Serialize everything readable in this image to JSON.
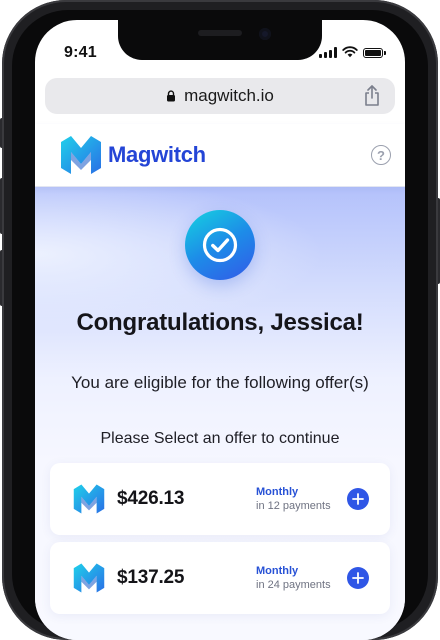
{
  "status_bar": {
    "time": "9:41"
  },
  "browser": {
    "url": "magwitch.io"
  },
  "app": {
    "brand_name": "Magwitch",
    "help_symbol": "?"
  },
  "main": {
    "headline": "Congratulations, Jessica!",
    "subheadline": "You are eligible for the following offer(s)",
    "prompt": "Please Select an offer to continue"
  },
  "offers": [
    {
      "amount": "$426.13",
      "frequency": "Monthly",
      "terms": "in 12 payments"
    },
    {
      "amount": "$137.25",
      "frequency": "Monthly",
      "terms": "in 24 payments"
    }
  ],
  "colors": {
    "brand": "#2445d6",
    "accent": "#2f56e6",
    "check_gradient_start": "#15d3e0",
    "check_gradient_end": "#3359e8"
  }
}
